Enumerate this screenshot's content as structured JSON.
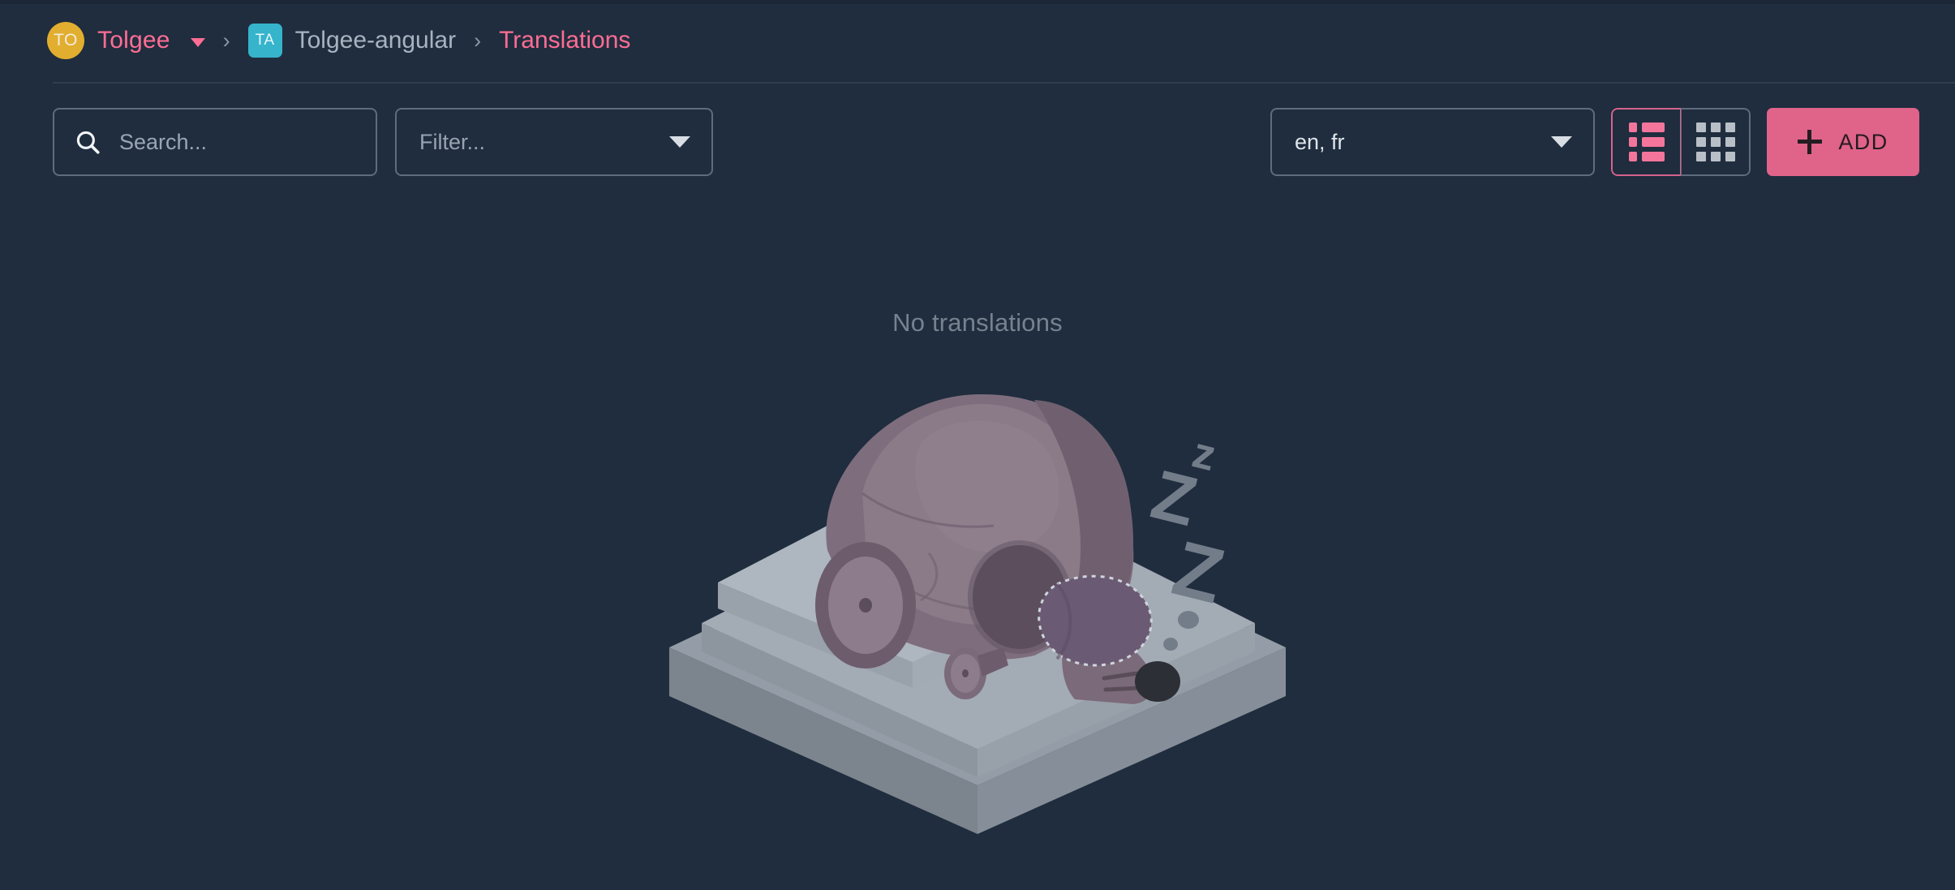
{
  "app": {
    "background_color": "#1f2d3e",
    "accent_color": "#ff6d94",
    "add_button_color": "#e0638a"
  },
  "breadcrumb": {
    "organization": {
      "avatar_initials": "TO",
      "avatar_color": "#e2ae2f",
      "label": "Tolgee",
      "caret_icon": "chevron-down-icon"
    },
    "separator": "›",
    "project": {
      "avatar_initials": "TA",
      "avatar_color": "#35b4cc",
      "label": "Tolgee-angular"
    },
    "current": "Translations"
  },
  "toolbar": {
    "search": {
      "icon": "search-icon",
      "placeholder": "Search...",
      "value": ""
    },
    "filter": {
      "label": "Filter...",
      "value": "",
      "caret_icon": "chevron-down-icon"
    },
    "languages": {
      "label": "en, fr",
      "value": "en, fr",
      "options": [
        "en",
        "fr"
      ],
      "caret_icon": "chevron-down-icon"
    },
    "view_toggle": {
      "list": {
        "icon": "view-list-icon",
        "active": true,
        "active_color": "#f4759b"
      },
      "grid": {
        "icon": "view-grid-icon",
        "active": false,
        "inactive_color": "#b9bfc7"
      }
    },
    "add_button": {
      "icon": "plus-icon",
      "label": "ADD"
    }
  },
  "empty_state": {
    "message": "No translations",
    "illustration": "sleeping-robot-mouse-on-bed-illustration",
    "illustration_parts": {
      "bed_top": "#9aa3ad",
      "bed_side": "#8e97a2",
      "body": "#7e6d7d",
      "body_light": "#8a7a88",
      "sleep_mask": "#6b5a73",
      "nose": "#2c2f35",
      "zzz": "#737d8a"
    }
  }
}
